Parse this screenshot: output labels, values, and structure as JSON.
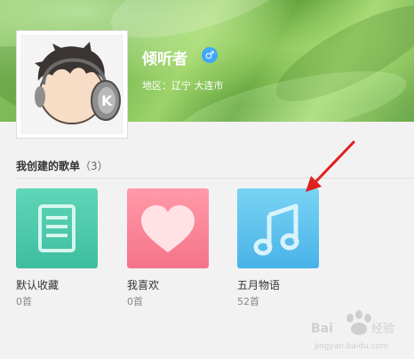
{
  "profile": {
    "username": "倾听者",
    "gender_icon": "male-icon",
    "region_label": "地区：辽宁 大连市"
  },
  "section": {
    "title": "我创建的歌单",
    "count": "（3）"
  },
  "playlists": [
    {
      "name": "默认收藏",
      "songs": "0首",
      "icon": "list-icon",
      "color": "#4ccaa9"
    },
    {
      "name": "我喜欢",
      "songs": "0首",
      "icon": "heart-icon",
      "color": "#f7808f"
    },
    {
      "name": "五月物语",
      "songs": "52首",
      "icon": "music-note-icon",
      "color": "#5ec0ef"
    }
  ],
  "colors": {
    "annotation_arrow": "#e0201f",
    "gender_badge": "#3fa9f5"
  },
  "watermark": {
    "text": "Bai经验",
    "url_text": "jingyan.baidu.com"
  }
}
